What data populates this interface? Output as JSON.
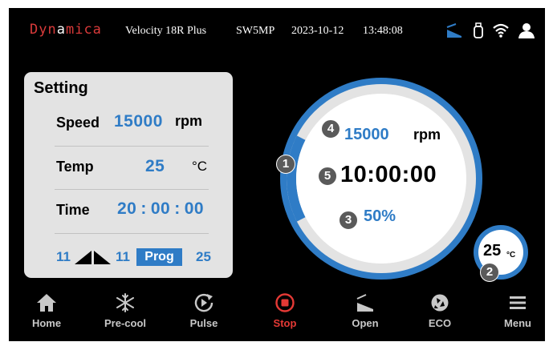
{
  "status_bar": {
    "logo_part1": "Dyn",
    "logo_part2": "a",
    "logo_part3": "mica",
    "model": "Velocity 18R Plus",
    "firmware": "SW5MP",
    "date": "2023-10-12",
    "time": "13:48:08",
    "icons": [
      "lid-icon",
      "usb-icon",
      "wifi-icon",
      "user-icon"
    ]
  },
  "setting": {
    "title": "Setting",
    "speed_label": "Speed",
    "speed_value": "15000",
    "speed_unit": "rpm",
    "temp_label": "Temp",
    "temp_value": "25",
    "temp_unit": "°C",
    "time_label": "Time",
    "time_h": "20",
    "time_m": "00",
    "time_s": "00",
    "time_sep": ":",
    "accel": "11",
    "decel": "11",
    "prog_label": "Prog",
    "prog_number": "25"
  },
  "gauge": {
    "speed_value": "15000",
    "speed_unit": "rpm",
    "run_time": "10:00:00",
    "progress_text": "50%",
    "progress_fraction": 0.5,
    "badge_1": "1",
    "badge_2": "2",
    "badge_3": "3",
    "badge_4": "4",
    "badge_5": "5"
  },
  "temp_bubble": {
    "value": "25",
    "unit": "°C"
  },
  "nav": {
    "items": [
      {
        "label": "Home",
        "icon": "home-icon"
      },
      {
        "label": "Pre-cool",
        "icon": "snowflake-icon"
      },
      {
        "label": "Pulse",
        "icon": "pulse-icon"
      },
      {
        "label": "Stop",
        "icon": "stop-icon",
        "active": true
      },
      {
        "label": "Open",
        "icon": "lid-open-icon"
      },
      {
        "label": "ECO",
        "icon": "eco-icon"
      },
      {
        "label": "Menu",
        "icon": "menu-icon"
      }
    ]
  },
  "colors": {
    "accent_blue": "#2f7cc6",
    "stop_red": "#e53935",
    "logo_red": "#d93a3a",
    "panel_gray": "#e3e3e3"
  }
}
